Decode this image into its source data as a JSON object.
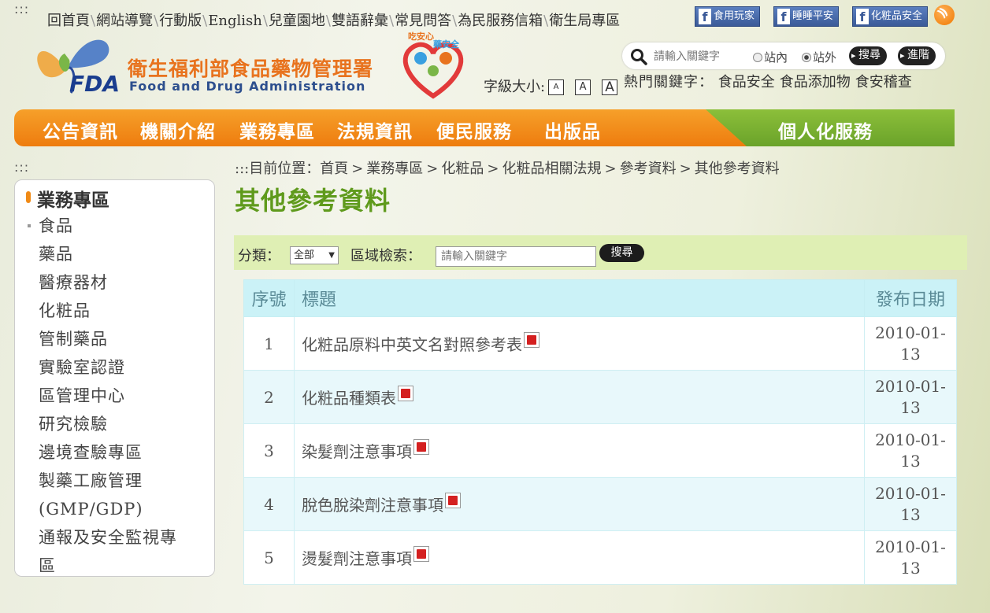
{
  "header": {
    "accesskey_top": ":::",
    "top_links": [
      "回首頁",
      "網站導覽",
      "行動版",
      "English",
      "兒童園地",
      "雙語辭彙",
      "常見問答",
      "為民服務信箱",
      "衛生局專區"
    ],
    "fb_buttons": [
      "食用玩家",
      "睡睡平安",
      "化粧品安全"
    ],
    "fb_letter": "f",
    "logo_fda": "FDA",
    "logo_cname": "衛生福利部食品藥物管理署",
    "logo_ename": "Food and Drug Administration",
    "mascot_text_1": "吃安心",
    "mascot_text_2": "藥安全",
    "search": {
      "placeholder": "請輸入關鍵字",
      "radio_inside": "站內",
      "radio_outside": "站外",
      "selected_radio": "站外",
      "search_button": "搜尋",
      "advanced_button": "進階"
    },
    "font_size_label": "字級大小:",
    "font_size_options": [
      "A",
      "A",
      "A"
    ],
    "hot_keywords_label": "熱門關鍵字：",
    "hot_keywords": [
      "食品安全",
      "食品添加物",
      "食安稽查"
    ]
  },
  "nav": {
    "items": [
      "公告資訊",
      "機關介紹",
      "業務專區",
      "法規資訊",
      "便民服務",
      "出版品"
    ],
    "personal": "個人化服務"
  },
  "accesskey_left": ":::",
  "breadcrumb": {
    "prefix": ":::目前位置：",
    "items": [
      "首頁",
      "業務專區",
      "化粧品",
      "化粧品相關法規",
      "參考資料",
      "其他參考資料"
    ],
    "separator": ">"
  },
  "sidebar": {
    "title": "業務專區",
    "items": [
      "食品",
      "藥品",
      "醫療器材",
      "化粧品",
      "管制藥品",
      "實驗室認證",
      "區管理中心",
      "研究檢驗",
      "邊境查驗專區",
      "製藥工廠管理",
      "(GMP/GDP)",
      "通報及安全監視專",
      "區"
    ]
  },
  "page_title": "其他參考資料",
  "filter": {
    "category_label": "分類：",
    "category_value": "全部",
    "area_search_label": "區域檢索：",
    "keyword_placeholder": "請輸入關鍵字",
    "search_button": "搜尋"
  },
  "table": {
    "headers": {
      "num": "序號",
      "title": "標題",
      "date": "發布日期"
    },
    "rows": [
      {
        "num": "1",
        "title": "化粧品原料中英文名對照參考表",
        "date_line1": "2010-01-",
        "date_line2": "13"
      },
      {
        "num": "2",
        "title": "化粧品種類表",
        "date_line1": "2010-01-",
        "date_line2": "13"
      },
      {
        "num": "3",
        "title": "染髮劑注意事項",
        "date_line1": "2010-01-",
        "date_line2": "13"
      },
      {
        "num": "4",
        "title": "脫色脫染劑注意事項",
        "date_line1": "2010-01-",
        "date_line2": "13"
      },
      {
        "num": "5",
        "title": "燙髮劑注意事項",
        "date_line1": "2010-01-",
        "date_line2": "13"
      }
    ],
    "attachment_icon": "pdf-icon"
  },
  "colors": {
    "nav_orange": "#ee7c0e",
    "nav_green": "#6aa32a",
    "title_green": "#5f9a1c",
    "table_header_bg": "#cbf2f7",
    "filter_bg": "#dfefb4",
    "logo_orange": "#e8731e",
    "logo_blue": "#1a3d8f"
  }
}
